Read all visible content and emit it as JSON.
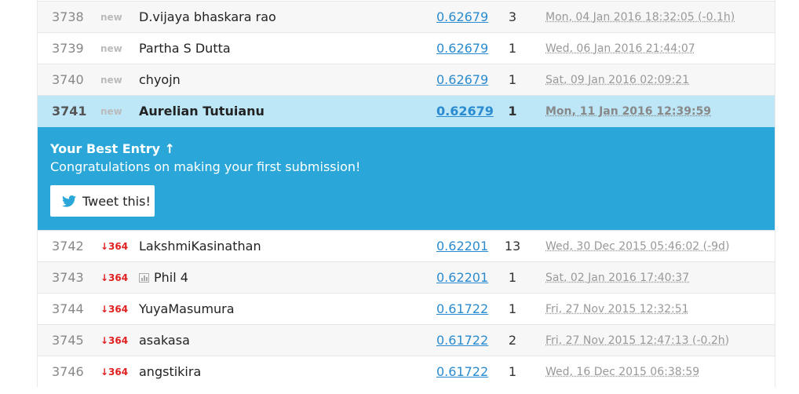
{
  "rows_before": [
    {
      "rank": "3738",
      "delta": "new",
      "delta_type": "new",
      "team": "D.vijaya bhaskara rao",
      "team_icon": "",
      "score": "0.62679",
      "entries": "3",
      "last": "Mon, 04 Jan 2016 18:32:05 (-0.1h)"
    },
    {
      "rank": "3739",
      "delta": "new",
      "delta_type": "new",
      "team": "Partha S Dutta",
      "team_icon": "",
      "score": "0.62679",
      "entries": "1",
      "last": "Wed, 06 Jan 2016 21:44:07"
    },
    {
      "rank": "3740",
      "delta": "new",
      "delta_type": "new",
      "team": "chyojn",
      "team_icon": "",
      "score": "0.62679",
      "entries": "1",
      "last": "Sat, 09 Jan 2016 02:09:21"
    }
  ],
  "my_row": {
    "rank": "3741",
    "delta": "new",
    "team": "Aurelian Tutuianu",
    "score": "0.62679",
    "entries": "1",
    "last": "Mon, 11 Jan 2016 12:39:59"
  },
  "best_entry": {
    "title": "Your Best Entry ↑",
    "message": "Congratulations on making your first submission!",
    "tweet_label": "Tweet this!",
    "tweet_icon": "twitter-bird-icon"
  },
  "rows_after": [
    {
      "rank": "3742",
      "delta": "↓364",
      "delta_type": "down",
      "team": "LakshmiKasinathan",
      "team_icon": "",
      "score": "0.62201",
      "entries": "13",
      "last": "Wed, 30 Dec 2015 05:46:02 (-9d)"
    },
    {
      "rank": "3743",
      "delta": "↓364",
      "delta_type": "down",
      "team": "Phil 4",
      "team_icon": "bar-chart-icon",
      "score": "0.62201",
      "entries": "1",
      "last": "Sat, 02 Jan 2016 17:40:37"
    },
    {
      "rank": "3744",
      "delta": "↓364",
      "delta_type": "down",
      "team": "YuyaMasumura",
      "team_icon": "",
      "score": "0.61722",
      "entries": "1",
      "last": "Fri, 27 Nov 2015 12:32:51"
    },
    {
      "rank": "3745",
      "delta": "↓364",
      "delta_type": "down",
      "team": "asakasa",
      "team_icon": "",
      "score": "0.61722",
      "entries": "2",
      "last": "Fri, 27 Nov 2015 12:47:13 (-0.2h)"
    },
    {
      "rank": "3746",
      "delta": "↓364",
      "delta_type": "down",
      "team": "angstikira",
      "team_icon": "",
      "score": "0.61722",
      "entries": "1",
      "last": "Wed, 16 Dec 2015 06:38:59"
    }
  ],
  "colors": {
    "accent": "#2aa7d8",
    "highlight": "#bde7f7",
    "drop": "#e02020",
    "link": "#2a8bd0"
  }
}
